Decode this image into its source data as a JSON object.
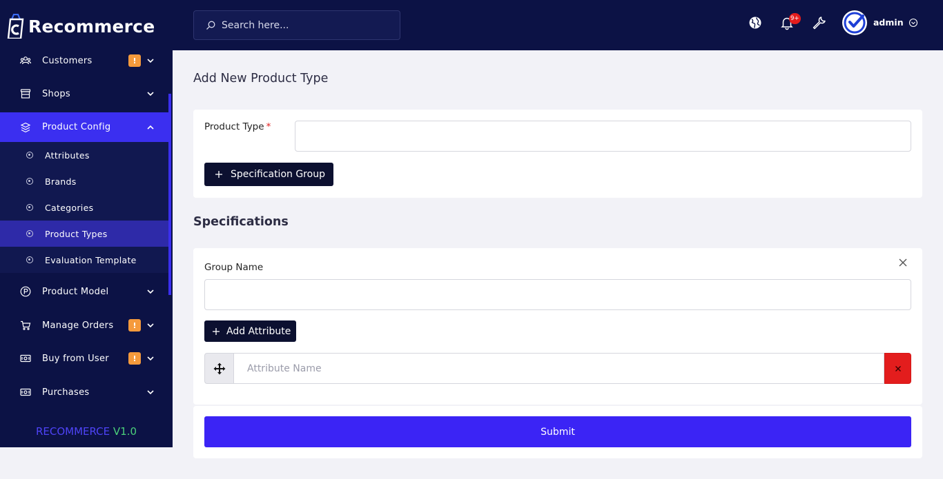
{
  "app": {
    "logo_text": "Recommerce",
    "version_brand": "RECOMMERCE",
    "version_number": "V1.0"
  },
  "sidebar": {
    "items": [
      {
        "label": "Customers",
        "icon": "users-icon",
        "badge": "!",
        "expanded": false
      },
      {
        "label": "Shops",
        "icon": "store-icon",
        "expanded": false
      },
      {
        "label": "Product Config",
        "icon": "cubes-icon",
        "expanded": true,
        "active": true
      },
      {
        "label": "Product Model",
        "icon": "p-circle-icon",
        "expanded": false
      },
      {
        "label": "Manage Orders",
        "icon": "cart-icon",
        "badge": "!",
        "expanded": false
      },
      {
        "label": "Buy from User",
        "icon": "money-icon",
        "badge": "!",
        "expanded": false
      },
      {
        "label": "Purchases",
        "icon": "money-icon",
        "expanded": false
      }
    ],
    "sub_items": [
      {
        "label": "Attributes"
      },
      {
        "label": "Brands"
      },
      {
        "label": "Categories"
      },
      {
        "label": "Product Types",
        "active": true
      },
      {
        "label": "Evaluation Template"
      }
    ]
  },
  "topbar": {
    "search_placeholder": "Search here...",
    "notification_count": "9+",
    "user_name": "admin"
  },
  "main": {
    "page_title": "Add New Product Type",
    "product_type_label": "Product Type",
    "required_mark": "*",
    "product_type_value": "",
    "spec_group_button": "Specification Group",
    "specifications_title": "Specifications",
    "group_name_label": "Group Name",
    "group_name_value": "",
    "add_attribute_button": "Add Attribute",
    "attribute_placeholder": "Attribute Name",
    "submit_button": "Submit"
  },
  "colors": {
    "sidebar_bg": "#0c1245",
    "accent": "#3b2ff0",
    "submit": "#3b24f5",
    "danger": "#e31d1d",
    "badge": "#f59a3c",
    "version_green": "#4bd07a"
  }
}
